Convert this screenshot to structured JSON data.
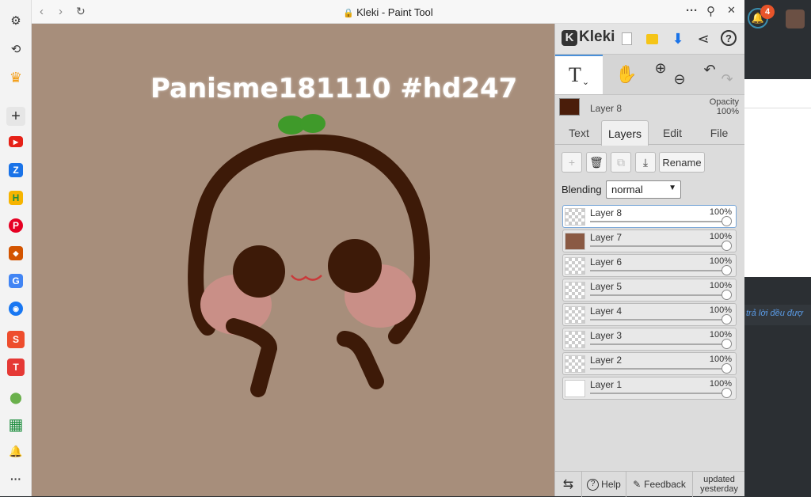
{
  "window": {
    "title": "Kleki - Paint Tool",
    "back_icon": "‹",
    "forward_icon": "›",
    "reload_icon": "↻",
    "more_icon": "···",
    "pin_icon": "⚲",
    "close_icon": "✕"
  },
  "sidebar": {
    "items": [
      {
        "name": "settings",
        "glyph": "⚙"
      },
      {
        "name": "history",
        "glyph": "⟲"
      },
      {
        "name": "crown",
        "glyph": "♛"
      },
      {
        "name": "add",
        "glyph": "+"
      },
      {
        "name": "youtube",
        "glyph": "▶",
        "color": "#e62117"
      },
      {
        "name": "zalo",
        "glyph": "Z",
        "color": "#1a73e8"
      },
      {
        "name": "h-app",
        "glyph": "H",
        "color": "#f6b400"
      },
      {
        "name": "pinterest",
        "glyph": "P",
        "color": "#e60023"
      },
      {
        "name": "office",
        "glyph": "◆",
        "color": "#d35400"
      },
      {
        "name": "translate",
        "glyph": "G",
        "color": "#4285f4"
      },
      {
        "name": "blue-app",
        "glyph": "◉",
        "color": "#1877f2"
      },
      {
        "name": "shopee",
        "glyph": "S",
        "color": "#ee4d2d"
      },
      {
        "name": "tiki",
        "glyph": "T",
        "color": "#e53935"
      },
      {
        "name": "green-app",
        "glyph": "⬤",
        "color": "#6ab04c"
      },
      {
        "name": "sheets",
        "glyph": "▦",
        "color": "#1e8e3e"
      },
      {
        "name": "notifications",
        "glyph": "🔔"
      },
      {
        "name": "more",
        "glyph": "···"
      }
    ]
  },
  "canvas": {
    "text": "Panisme181110 #hd247",
    "bg": "#a78e7b"
  },
  "kleki": {
    "logo_text": "Kleki",
    "header_icons": [
      "new-file-icon",
      "folder-icon",
      "download-icon",
      "share-icon",
      "help-icon"
    ],
    "tools": {
      "text_tool": "T",
      "hand_tool": "✋",
      "zoom_in": "⊕",
      "zoom_out": "⊖",
      "undo": "↶",
      "redo": "↷"
    },
    "current_layer": {
      "name": "Layer 8",
      "opacity_label": "Opacity",
      "opacity_value": "100%"
    },
    "tabs": [
      "Text",
      "Layers",
      "Edit",
      "File"
    ],
    "active_tab": "Layers",
    "layer_buttons": {
      "add": "+",
      "delete": "🗑",
      "duplicate": "⧉",
      "merge": "⤓",
      "rename": "Rename"
    },
    "blending": {
      "label": "Blending",
      "value": "normal"
    },
    "layers": [
      {
        "name": "Layer 8",
        "opacity": "100%",
        "selected": true
      },
      {
        "name": "Layer 7",
        "opacity": "100%",
        "selected": false
      },
      {
        "name": "Layer 6",
        "opacity": "100%",
        "selected": false
      },
      {
        "name": "Layer 5",
        "opacity": "100%",
        "selected": false
      },
      {
        "name": "Layer 4",
        "opacity": "100%",
        "selected": false
      },
      {
        "name": "Layer 3",
        "opacity": "100%",
        "selected": false
      },
      {
        "name": "Layer 2",
        "opacity": "100%",
        "selected": false
      },
      {
        "name": "Layer 1",
        "opacity": "100%",
        "selected": false
      }
    ],
    "footer": {
      "swap": "⇆",
      "help": "Help",
      "feedback": "Feedback",
      "updated_line1": "updated",
      "updated_line2": "yesterday"
    }
  },
  "background_page": {
    "notification_count": "4",
    "partial_text": "trả lời đều đượ"
  }
}
